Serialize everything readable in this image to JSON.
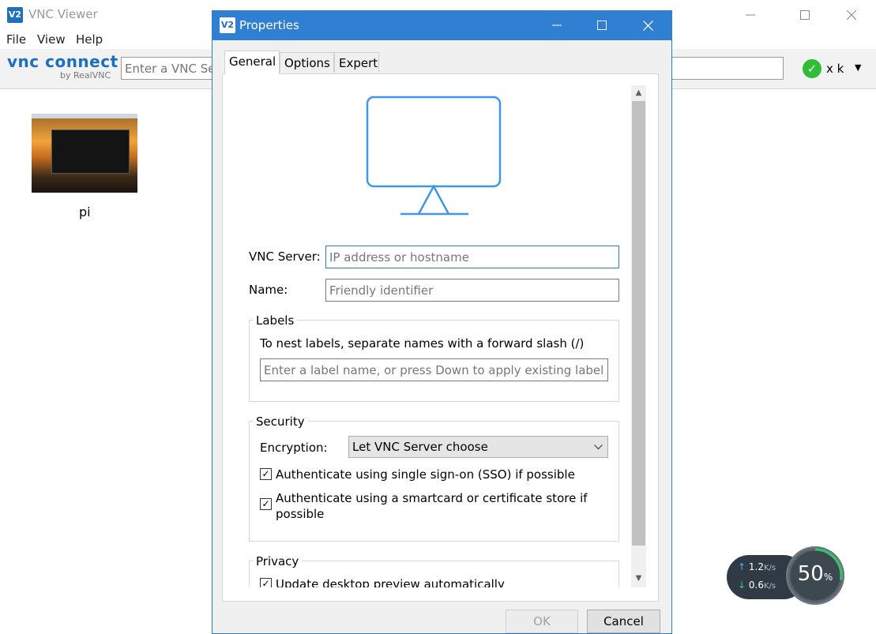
{
  "main": {
    "title": "VNC Viewer",
    "menu": [
      "File",
      "View",
      "Help"
    ],
    "logo_text": "vnc connect",
    "logo_sub": "by RealVNC",
    "search_placeholder": "Enter a VNC Server address or search",
    "user": "x k",
    "thumbnail_label": "pi"
  },
  "dialog": {
    "title": "Properties",
    "tabs": [
      "General",
      "Options",
      "Expert"
    ],
    "vnc_server_label": "VNC Server:",
    "vnc_server_placeholder": "IP address or hostname",
    "name_label": "Name:",
    "name_placeholder": "Friendly identifier",
    "labels": {
      "title": "Labels",
      "hint": "To nest labels, separate names with a forward slash (/)",
      "placeholder": "Enter a label name, or press Down to apply existing labels"
    },
    "security": {
      "title": "Security",
      "encryption_label": "Encryption:",
      "encryption_value": "Let VNC Server choose",
      "sso_label": "Authenticate using single sign-on (SSO) if possible",
      "sso_checked": true,
      "smartcard_label_line1": "Authenticate using a smartcard or certificate store if",
      "smartcard_label_line2": "possible",
      "smartcard_checked": true
    },
    "privacy": {
      "title": "Privacy",
      "update_preview_label": "Update desktop preview automatically",
      "update_preview_checked": true
    },
    "ok_label": "OK",
    "cancel_label": "Cancel"
  },
  "network": {
    "upload": "1.2",
    "download": "0.6",
    "unit": "K/s",
    "usage": "50",
    "usage_unit": "%"
  },
  "colors": {
    "accent": "#2f7fd2",
    "ok_green": "#2ebd36",
    "monitor_blue": "#3d97ea"
  }
}
